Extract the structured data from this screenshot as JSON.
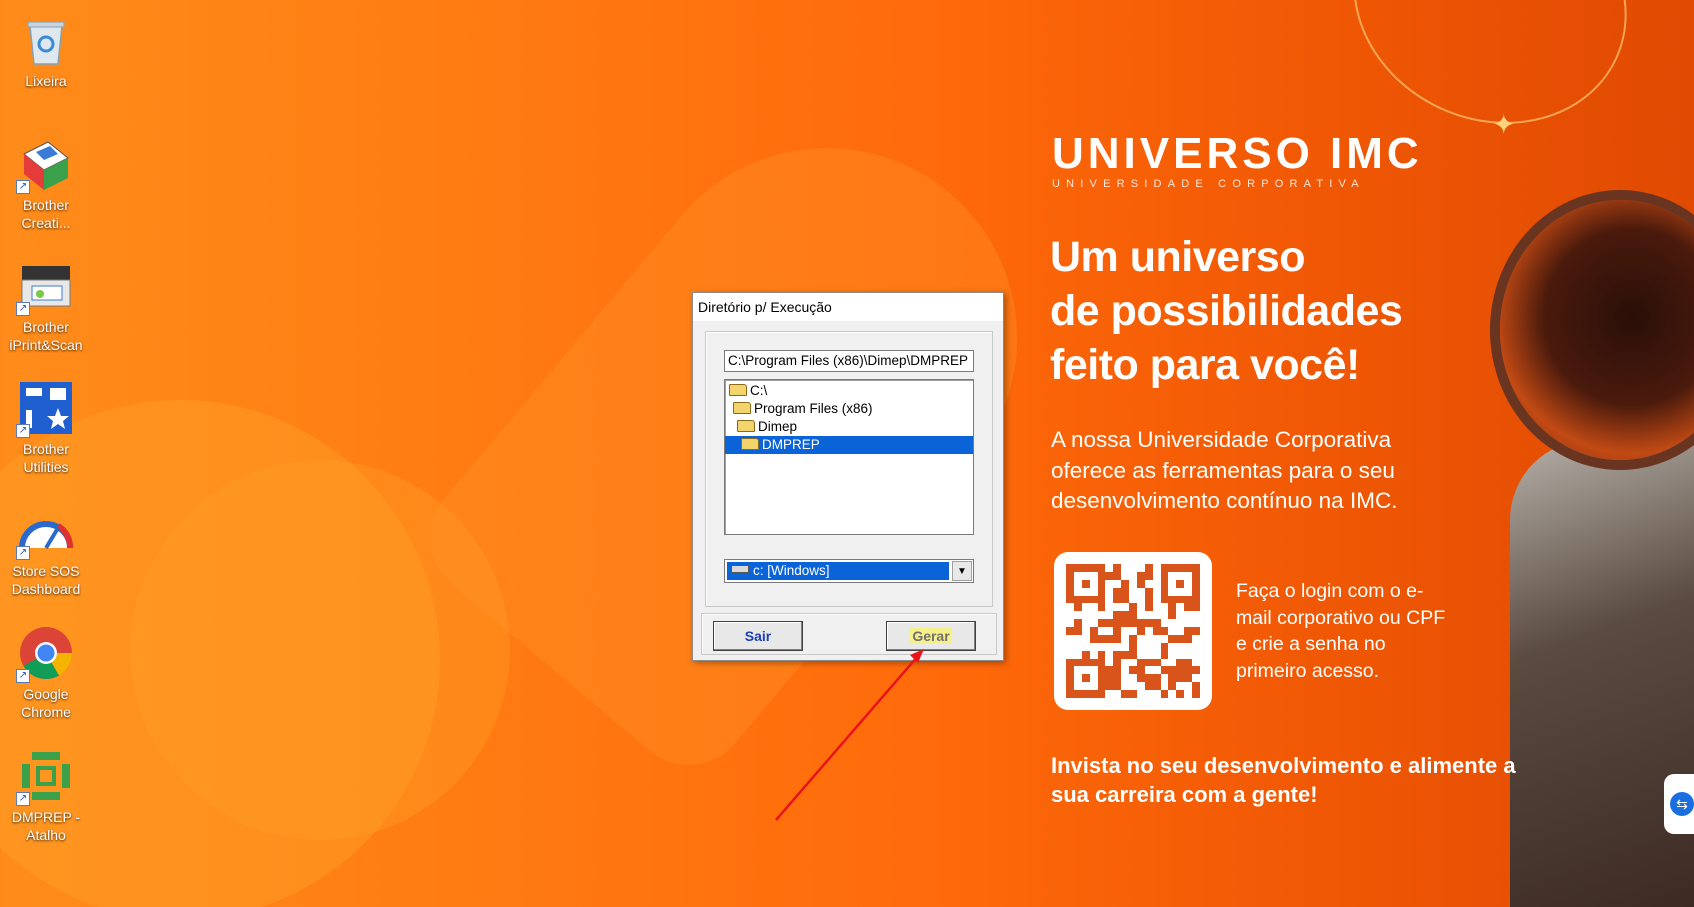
{
  "desktop": {
    "icons": [
      {
        "label": "Lixeira",
        "icon": "recycle-bin-icon"
      },
      {
        "label": "Brother\nCreati...",
        "icon": "brother-creative-center-icon"
      },
      {
        "label": "Brother\niPrint&Scan",
        "icon": "scanner-icon"
      },
      {
        "label": "Brother\nUtilities",
        "icon": "brother-utilities-icon"
      },
      {
        "label": "Store SOS\nDashboard",
        "icon": "gauge-icon"
      },
      {
        "label": "Google\nChrome",
        "icon": "chrome-icon"
      },
      {
        "label": "DMPREP -\nAtalho",
        "icon": "dmprep-icon"
      }
    ]
  },
  "dialog": {
    "title": "Diretório p/ Execução",
    "path": "C:\\Program Files (x86)\\Dimep\\DMPREP",
    "tree": [
      {
        "label": "C:\\",
        "indent": 0,
        "selected": false
      },
      {
        "label": "Program Files (x86)",
        "indent": 1,
        "selected": false
      },
      {
        "label": "Dimep",
        "indent": 2,
        "selected": false
      },
      {
        "label": "DMPREP",
        "indent": 3,
        "selected": true
      }
    ],
    "drive": "c: [Windows]",
    "buttons": {
      "exit": "Sair",
      "generate": "Gerar"
    }
  },
  "promo": {
    "brand": "UNIVERSO IMC",
    "brand_subtitle": "UNIVERSIDADE CORPORATIVA",
    "headline": [
      "Um universo",
      "de possibilidades",
      "feito para você!"
    ],
    "lead": "A nossa Universidade Corporativa oferece as ferramentas para o seu desenvolvimento contínuo na IMC.",
    "login": "Faça o login com o e-mail corporativo ou CPF e crie a senha no primeiro acesso.",
    "cta": "Invista no seu desenvolvimento e alimente a sua carreira com a gente!"
  },
  "colors": {
    "accent_orange": "#ff7a12",
    "selection_blue": "#0a64d8",
    "qr_color": "#d9541a"
  }
}
